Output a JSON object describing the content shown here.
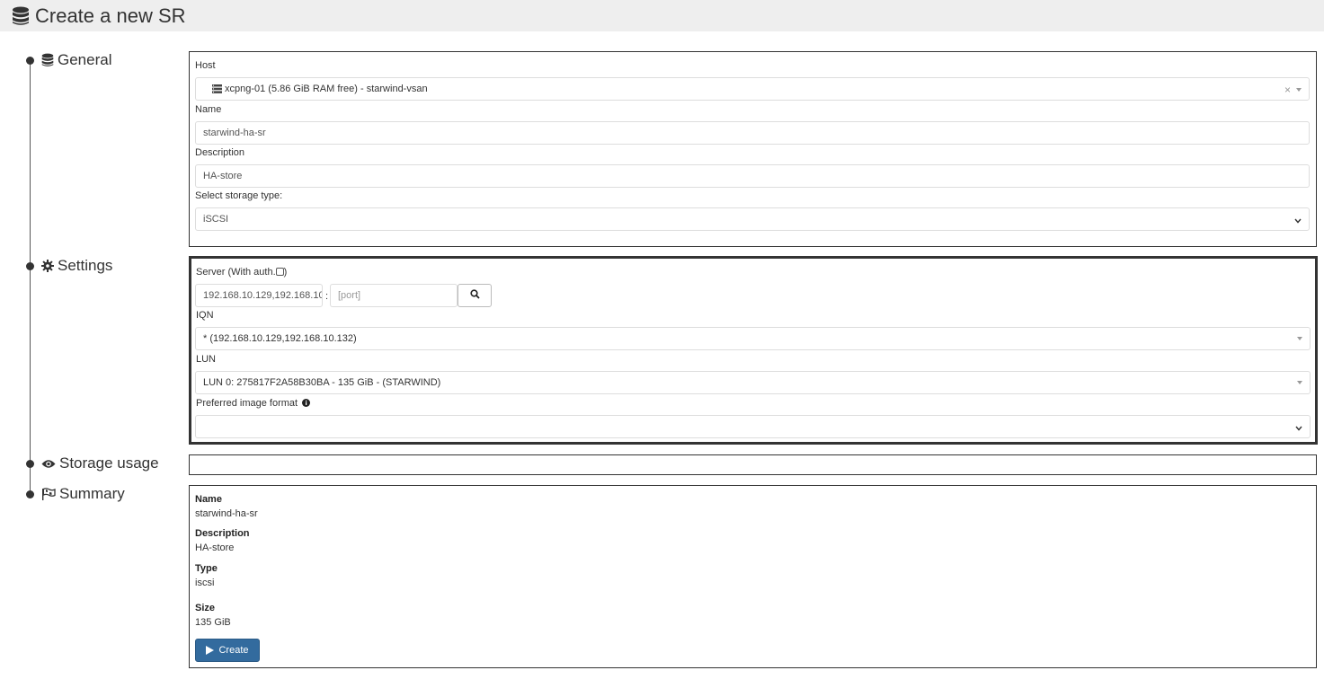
{
  "page": {
    "title": "Create a new SR"
  },
  "steps": {
    "general": "General",
    "settings": "Settings",
    "storage_usage": "Storage usage",
    "summary": "Summary"
  },
  "general": {
    "host_label": "Host",
    "host_value": "xcpng-01 (5.86 GiB RAM free) - starwind-vsan",
    "host_clear": "×",
    "name_label": "Name",
    "name_value": "starwind-ha-sr",
    "description_label": "Description",
    "description_value": "HA-store",
    "storage_type_label": "Select storage type:",
    "storage_type_value": "iSCSI"
  },
  "settings": {
    "server_label": "Server (With auth.",
    "server_label_close": ")",
    "server_value": "192.168.10.129,192.168.10",
    "colon": ":",
    "port_placeholder": "[port]",
    "iqn_label": "IQN",
    "iqn_value": "* (192.168.10.129,192.168.10.132)",
    "lun_label": "LUN",
    "lun_value": "LUN 0: 275817F2A58B30BA - 135 GiB - (STARWIND)",
    "format_label": "Preferred image format",
    "format_value": ""
  },
  "summary": {
    "name_label": "Name",
    "name_value": "starwind-ha-sr",
    "description_label": "Description",
    "description_value": "HA-store",
    "type_label": "Type",
    "type_value": "iscsi",
    "size_label": "Size",
    "size_value": "135 GiB",
    "create_label": "Create"
  },
  "colors": {
    "header_bg": "#eeeeee",
    "primary_button": "#336b9e",
    "border": "#333333"
  },
  "icons": [
    "database-icon",
    "gear-icon",
    "eye-icon",
    "flag-icon",
    "server-icon",
    "search-icon",
    "info-icon",
    "play-icon",
    "chevron-down-icon",
    "checkbox-icon"
  ]
}
